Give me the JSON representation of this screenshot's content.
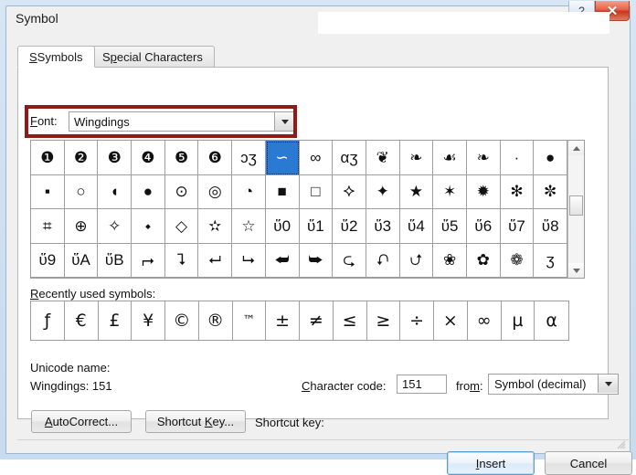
{
  "window": {
    "title": "Symbol",
    "buttons": {
      "help": "?",
      "close": "✕"
    }
  },
  "tabs": [
    {
      "label": "Symbols",
      "accel": "S",
      "active": true
    },
    {
      "label": "Special Characters",
      "accel": "p",
      "active": false
    }
  ],
  "font": {
    "label": "Font:",
    "accel": "F",
    "value": "Wingdings",
    "dropdown_icon": "chevron-down-icon"
  },
  "annotation": {
    "color": "#8f1a18",
    "target": "font-row"
  },
  "symbol_grid": {
    "columns": 16,
    "rows": 4,
    "selected_index": 7,
    "cells": [
      "❶",
      "❷",
      "❸",
      "❹",
      "❺",
      "❻",
      "ɔʒ",
      "∽",
      "∞",
      "αʒ",
      "❦",
      "❧",
      "☙",
      "❧",
      "·",
      "●",
      "▪",
      "○",
      "◖",
      "●",
      "⊙",
      "◎",
      "◔",
      "■",
      "□",
      "⯎",
      "✦",
      "★",
      "✶",
      "✹",
      "✻",
      "✼",
      "⌗",
      "⊕",
      "✧",
      "⬩",
      "◇",
      "✫",
      "☆",
      "ὕ0",
      "ὕ1",
      "ὕ2",
      "ὕ3",
      "ὕ4",
      "ὕ5",
      "ὕ6",
      "ὕ7",
      "ὕ8",
      "ὕ9",
      "ὕA",
      "ὕB",
      "⮣",
      "⮧",
      "⮠",
      "⮡",
      "⮨",
      "⮩",
      "⮎",
      "⮏",
      "⮍",
      "❀",
      "✿",
      "❁",
      "ʒ"
    ]
  },
  "recent": {
    "label": "Recently used symbols:",
    "accel": "R",
    "symbols": [
      "ƒ",
      "€",
      "£",
      "¥",
      "©",
      "®",
      "™",
      "±",
      "≠",
      "≤",
      "≥",
      "÷",
      "×",
      "∞",
      "µ",
      "α"
    ]
  },
  "unicode": {
    "label": "Unicode name:",
    "value": "Wingdings: 151"
  },
  "character_code": {
    "label": "Character code:",
    "accel": "C",
    "value": "151"
  },
  "from": {
    "label": "from:",
    "accel": "m",
    "value": "Symbol (decimal)",
    "dropdown_icon": "chevron-down-icon"
  },
  "actions": {
    "autocorrect": "AutoCorrect...",
    "autocorrect_accel": "A",
    "shortcut_key": "Shortcut Key...",
    "shortcut_key_accel": "K",
    "shortcut_label": "Shortcut key:",
    "insert": "Insert",
    "insert_accel": "I",
    "cancel": "Cancel"
  },
  "scrollbar": {
    "up_icon": "triangle-up-icon",
    "down_icon": "triangle-down-icon"
  }
}
